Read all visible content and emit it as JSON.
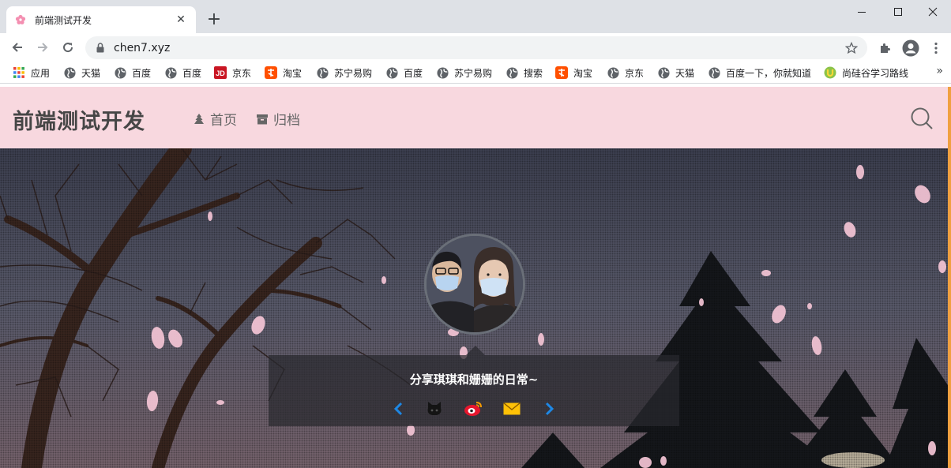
{
  "browser": {
    "tab_title": "前端测试开发",
    "tab_close": "✕",
    "new_tab": "+",
    "url": "chen7.xyz",
    "window": {
      "minimize": "—",
      "maximize": "☐",
      "close": "✕"
    }
  },
  "bookmarks": {
    "items": [
      {
        "label": "应用",
        "icon": "apps-grid-icon"
      },
      {
        "label": "天猫",
        "icon": "globe-icon"
      },
      {
        "label": "百度",
        "icon": "globe-icon"
      },
      {
        "label": "百度",
        "icon": "globe-icon"
      },
      {
        "label": "京东",
        "icon": "jd-icon"
      },
      {
        "label": "淘宝",
        "icon": "taobao-icon"
      },
      {
        "label": "苏宁易购",
        "icon": "globe-icon"
      },
      {
        "label": "百度",
        "icon": "globe-icon"
      },
      {
        "label": "苏宁易购",
        "icon": "globe-icon"
      },
      {
        "label": "搜索",
        "icon": "globe-icon"
      },
      {
        "label": "淘宝",
        "icon": "taobao-icon"
      },
      {
        "label": "京东",
        "icon": "globe-icon"
      },
      {
        "label": "天猫",
        "icon": "globe-icon"
      },
      {
        "label": "百度一下，你就知道",
        "icon": "globe-icon"
      },
      {
        "label": "尚硅谷学习路线",
        "icon": "shangguigu-icon"
      }
    ],
    "more": "»"
  },
  "site": {
    "title": "前端测试开发",
    "nav": [
      {
        "label": "首页",
        "icon": "home-icon"
      },
      {
        "label": "归档",
        "icon": "archive-icon"
      }
    ],
    "motto": "分享琪琪和姗姗的日常~",
    "social": [
      "prev-arrow-icon",
      "github-icon",
      "weibo-icon",
      "mail-icon",
      "next-arrow-icon"
    ]
  },
  "colors": {
    "header_bg": "#f8d8df",
    "title_text": "#464646",
    "accent_blue": "#1e88e5",
    "weibo_red": "#e6162d",
    "mail_yellow": "#ffc107",
    "petal_pink": "#f6c6d6",
    "scroll_accent": "#f0a040"
  }
}
